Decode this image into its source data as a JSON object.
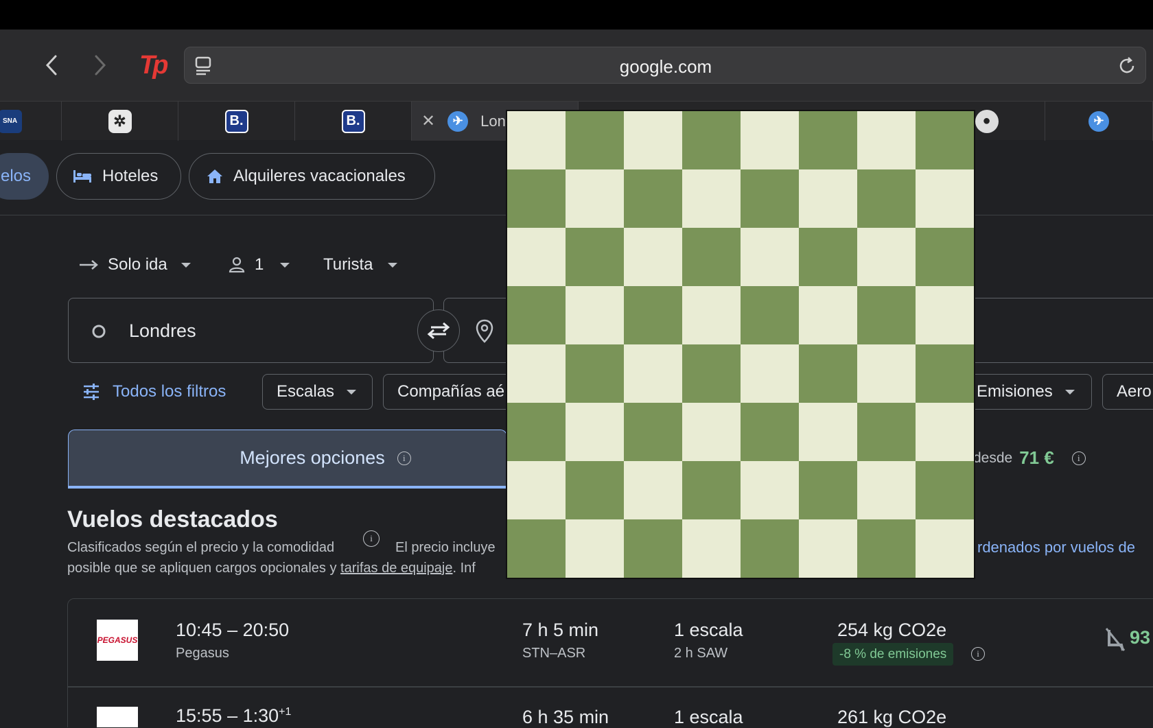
{
  "browser": {
    "url": "google.com",
    "tab_active_title": "Lon",
    "tabs": [
      {
        "icon": "sna-icon"
      },
      {
        "icon": "openai-icon"
      },
      {
        "icon": "booking-icon",
        "label": "B."
      },
      {
        "icon": "booking-icon",
        "label": "B."
      },
      {
        "icon": "google-flights-icon",
        "active": true
      },
      {
        "icon": "mickey-icon"
      },
      {
        "icon": "google-flights-icon"
      }
    ]
  },
  "top_nav": {
    "flights_partial": "elos",
    "hotels": "Hoteles",
    "vacation_rentals": "Alquileres vacacionales"
  },
  "search": {
    "trip_type": "Solo ida",
    "passengers": "1",
    "cabin": "Turista",
    "origin": "Londres"
  },
  "filters": {
    "all_filters": "Todos los filtros",
    "stops": "Escalas",
    "airlines": "Compañías aé",
    "emissions": "Emisiones",
    "airports_partial": "Aero"
  },
  "sort_tabs": {
    "best": "Mejores opciones",
    "cheapest_prefix": "desde",
    "cheapest_price": "71 €"
  },
  "results": {
    "title": "Vuelos destacados",
    "subtitle_line1": "Clasificados según el precio y la comodidad",
    "price_note": "El precio incluye",
    "sorted_link": "rdenados por vuelos de",
    "subtitle_line2_a": "posible que se apliquen cargos opcionales y ",
    "baggage_link": "tarifas de equipaje",
    "subtitle_line2_b": ". Inf"
  },
  "flights": [
    {
      "times": "10:45 – 20:50",
      "airline": "Pegasus",
      "airline_logo_text": "PEGASUS",
      "duration": "7 h 5 min",
      "route": "STN–ASR",
      "stops": "1 escala",
      "layover": "2 h SAW",
      "emissions": "254 kg CO2e",
      "emissions_badge": "-8 % de emisiones",
      "price_partial": "93"
    },
    {
      "times": "15:55 – 1:30",
      "times_sup": "+1",
      "duration": "6 h 35 min",
      "stops": "1 escala",
      "emissions": "261 kg CO2e"
    }
  ],
  "colors": {
    "page_bg": "#202124",
    "accent_blue": "#8ab4f8",
    "price_green": "#81c995",
    "board_light": "#e9ecd4",
    "board_dark": "#7a9458"
  }
}
